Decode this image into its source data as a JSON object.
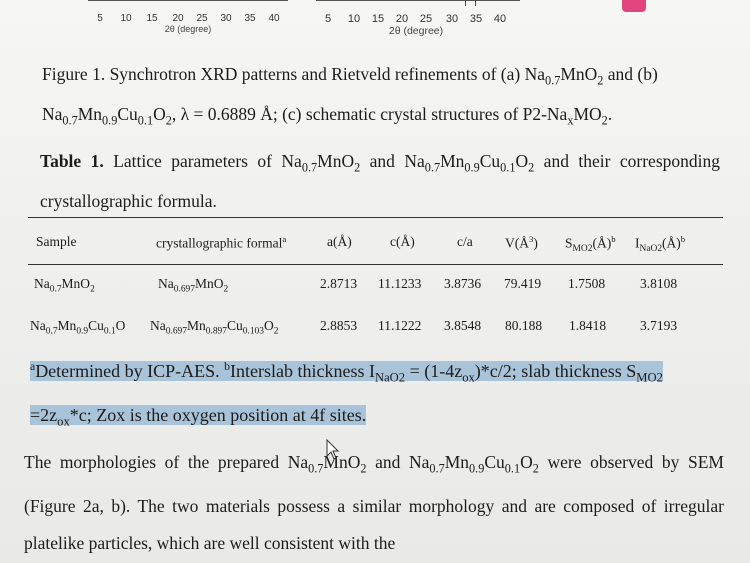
{
  "axes": {
    "left": {
      "ticks": [
        "5",
        "10",
        "15",
        "20",
        "25",
        "30",
        "35",
        "40"
      ],
      "label": "2θ (degree)"
    },
    "right": {
      "ticks": [
        "5",
        "10",
        "15",
        "20",
        "25",
        "30",
        "35",
        "40"
      ],
      "label": "2θ (degree)"
    }
  },
  "figure_caption": {
    "lead": "Figure 1. Synchrotron XRD patterns and Rietveld refinements of (a) Na",
    "s1": "0.7",
    "t1": "MnO",
    "s2": "2",
    "t2": " and (b) Na",
    "s3": "0.7",
    "t3": "Mn",
    "s4": "0.9",
    "t4": "Cu",
    "s5": "0.1",
    "t5": "O",
    "s6": "2",
    "t6": ", λ = 0.6889 Å; (c) schematic crystal structures of P2-Na",
    "s7": "x",
    "t7": "MO",
    "s8": "2",
    "t8": "."
  },
  "table_title": {
    "label": "Table 1.",
    "t0": " Lattice parameters of Na",
    "s1": "0.7",
    "t1": "MnO",
    "s2": "2",
    "t2": " and Na",
    "s3": "0.7",
    "t3": "Mn",
    "s4": "0.9",
    "t4": "Cu",
    "s5": "0.1",
    "t5": "O",
    "s6": "2",
    "t6": " and their corresponding crystallographic formula."
  },
  "table": {
    "headers": {
      "sample": "Sample",
      "formula": "crystallographic formal",
      "formula_sup": "a",
      "a": "a(Å)",
      "c": "c(Å)",
      "ca": "c/a",
      "v": "V(Å",
      "v_sup": "3",
      "v_end": ")",
      "smo2": "S",
      "smo2_sub": "MO2",
      "smo2_end": "(Å)",
      "smo2_sup": "b",
      "inao2": "I",
      "inao2_sub": "NaO2",
      "inao2_end": "(Å)",
      "inao2_sup": "b"
    },
    "rows": [
      {
        "sample": [
          "Na",
          "0.7",
          "MnO",
          "2"
        ],
        "formula": [
          "Na",
          "0.697",
          "MnO",
          "2"
        ],
        "a": "2.8713",
        "c": "11.1233",
        "ca": "3.8736",
        "v": "79.419",
        "smo2": "1.7508",
        "inao2": "3.8108"
      },
      {
        "sample": [
          "Na",
          "0.7",
          "Mn",
          "0.9",
          "Cu",
          "0.1",
          "O"
        ],
        "formula": [
          "Na",
          "0.697",
          "Mn",
          "0.897",
          "Cu",
          "0.103",
          "O",
          "2"
        ],
        "a": "2.8853",
        "c": "11.1222",
        "ca": "3.8548",
        "v": "80.188",
        "smo2": "1.8418",
        "inao2": "3.7193"
      }
    ]
  },
  "footnote": {
    "a_sup": "a",
    "t1": "Determined by ICP-AES. ",
    "b_sup": "b",
    "t2": "Interslab thickness I",
    "s1": "NaO2",
    "t3": " = (1-4z",
    "s2": "ox",
    "t4": ")*c/2; slab thickness S",
    "s3": "MO2",
    "t5": " =2z",
    "s4": "ox",
    "t6": "*c; Zox is the oxygen position at 4f sites."
  },
  "paragraph": {
    "t1": "The morphologies of the prepared Na",
    "s1": "0.7",
    "t2": "MnO",
    "s2": "2",
    "t3": " and Na",
    "s3": "0.7",
    "t4": "Mn",
    "s4": "0.9",
    "t5": "Cu",
    "s5": "0.1",
    "t6": "O",
    "s6": "2",
    "t7": " were observed by SEM (Figure 2a, b). The two materials possess a similar morphology and are composed of irregular platelike particles, which are well consistent with the"
  },
  "colors": {
    "highlight": "#a9c3d9",
    "accent_mark": "#e0457e"
  },
  "icons": [
    "mouse-cursor-icon"
  ]
}
